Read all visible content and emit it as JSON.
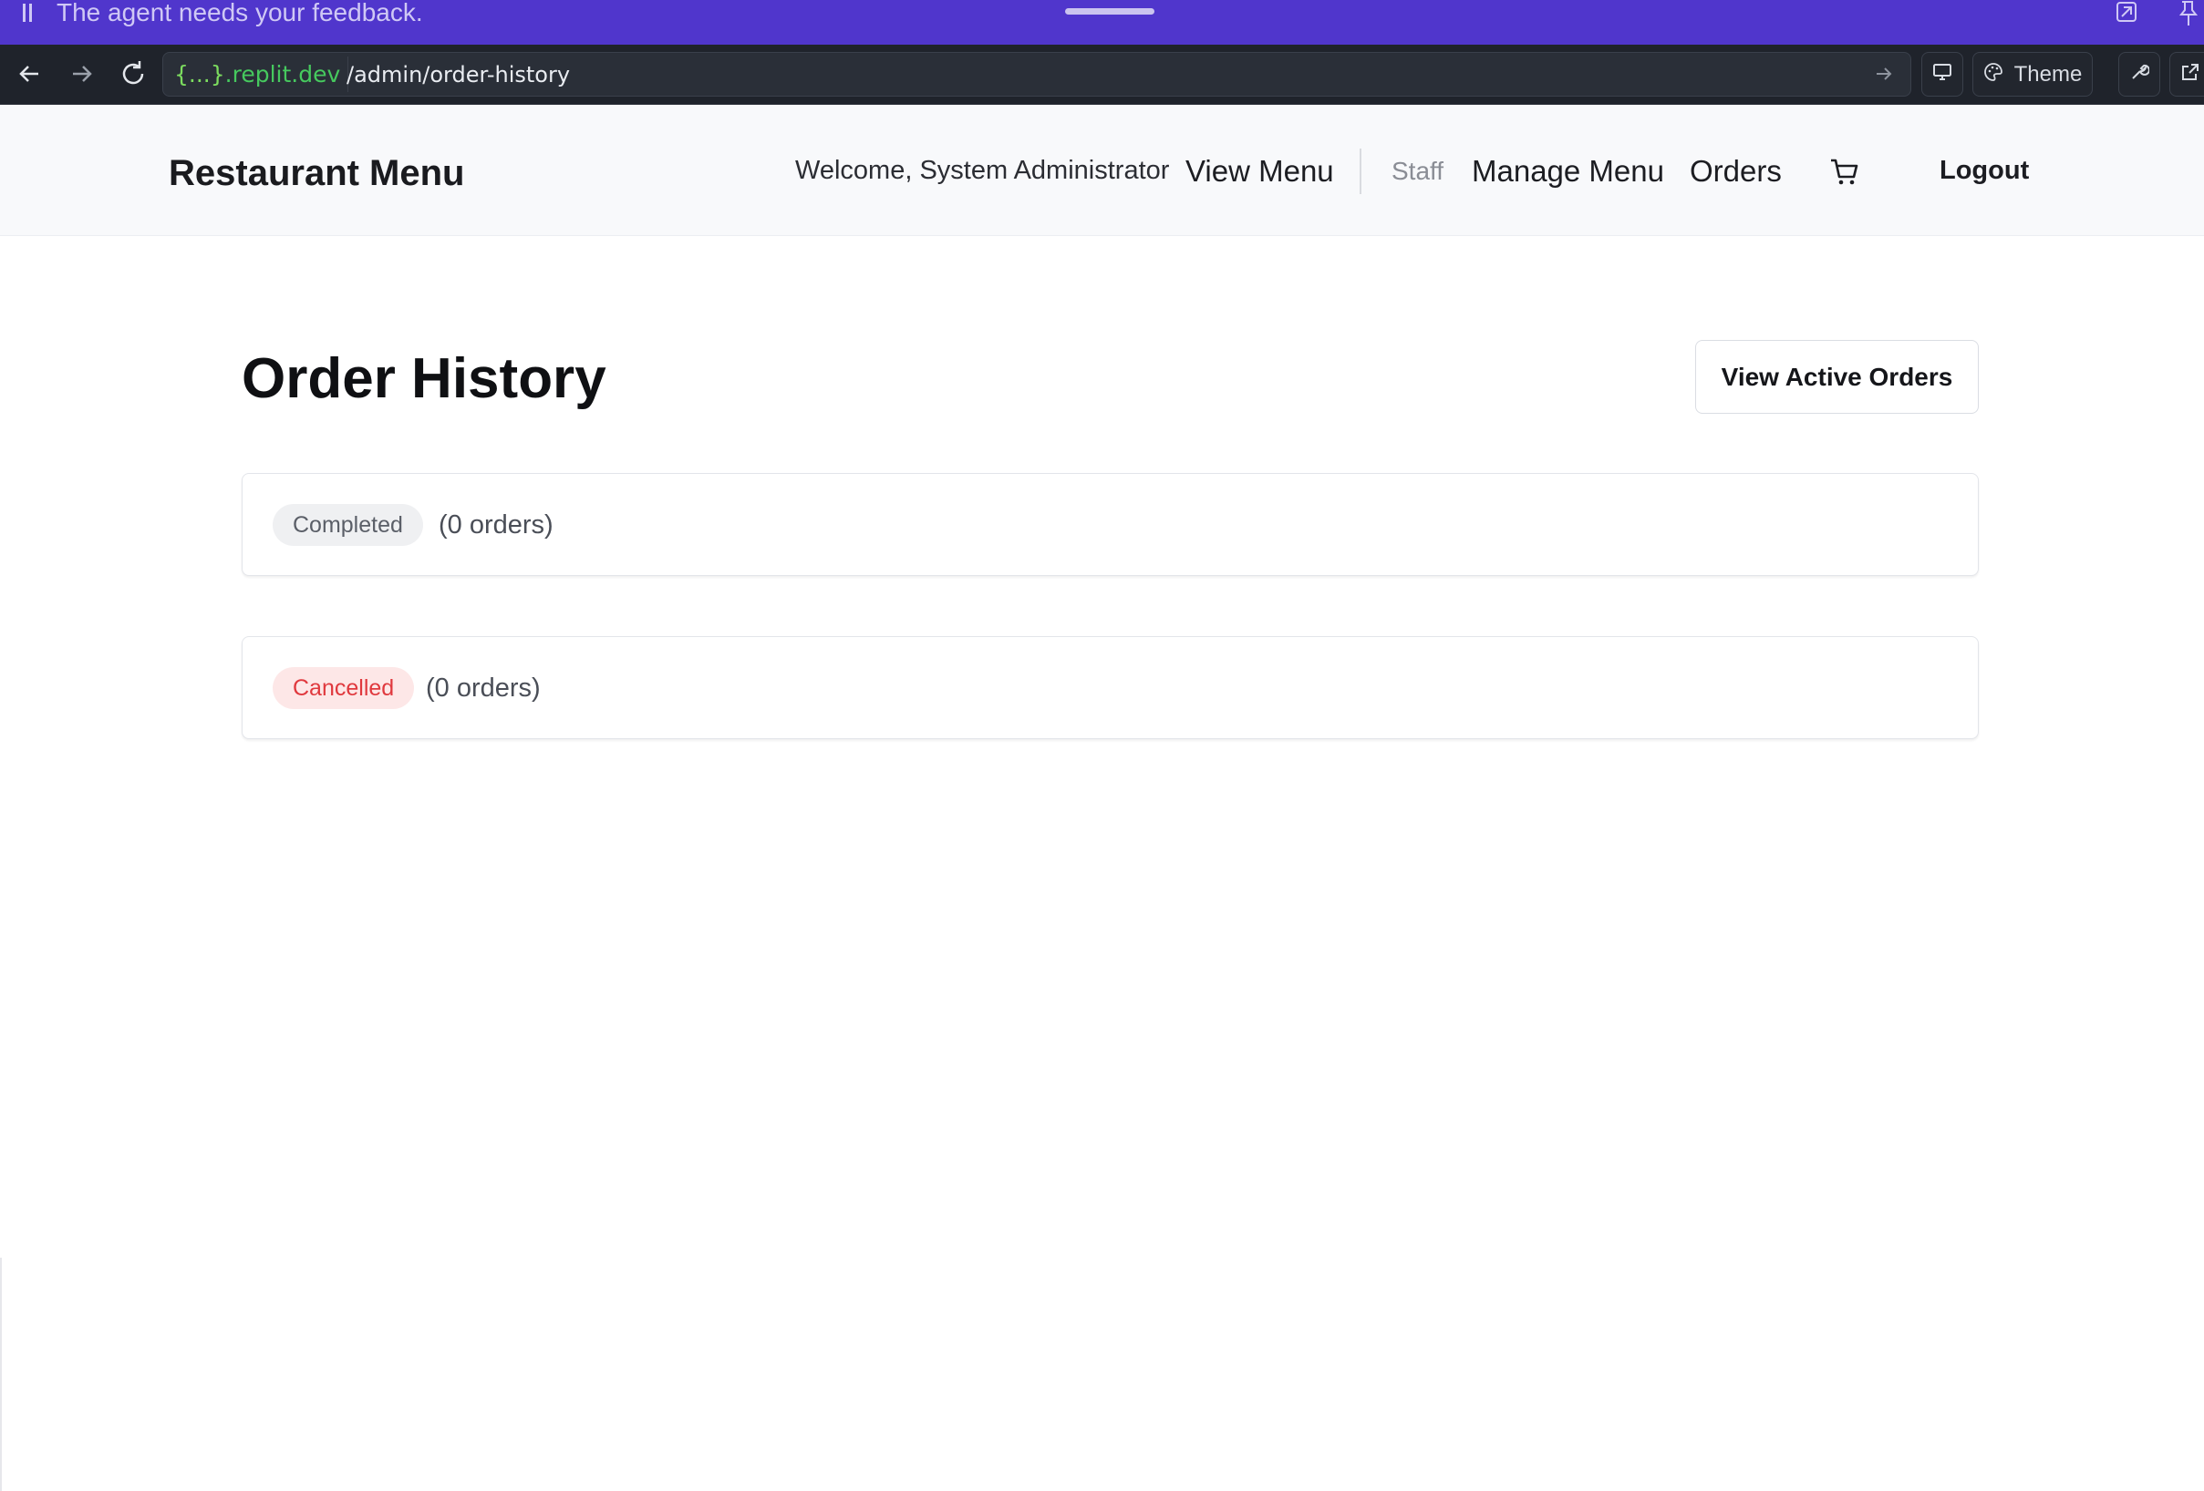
{
  "banner": {
    "message": "The agent needs your feedback.",
    "color": "#5036cc"
  },
  "browser": {
    "url_host_brace": "{...}",
    "url_host_domain": ".replit.dev",
    "url_path": "/admin/order-history",
    "theme_label": "Theme",
    "icons": [
      "back-arrow-icon",
      "forward-arrow-icon",
      "reload-icon",
      "go-arrow-icon",
      "monitor-icon",
      "palette-icon",
      "wrench-icon",
      "external-link-icon"
    ]
  },
  "header": {
    "brand": "Restaurant Menu",
    "welcome": "Welcome, System Administrator",
    "nav": {
      "view_menu": "View Menu",
      "staff": "Staff",
      "manage_menu": "Manage Menu",
      "orders": "Orders",
      "logout": "Logout"
    },
    "cart_icon": "cart-icon"
  },
  "main": {
    "title": "Order History",
    "view_active_orders": "View Active Orders",
    "sections": [
      {
        "status": "Completed",
        "count_text": "(0 orders)",
        "badge_color": "#eff0f2",
        "badge_text_color": "#5b5f68"
      },
      {
        "status": "Cancelled",
        "count_text": "(0 orders)",
        "badge_color": "#fde7e7",
        "badge_text_color": "#e0393e"
      }
    ]
  }
}
